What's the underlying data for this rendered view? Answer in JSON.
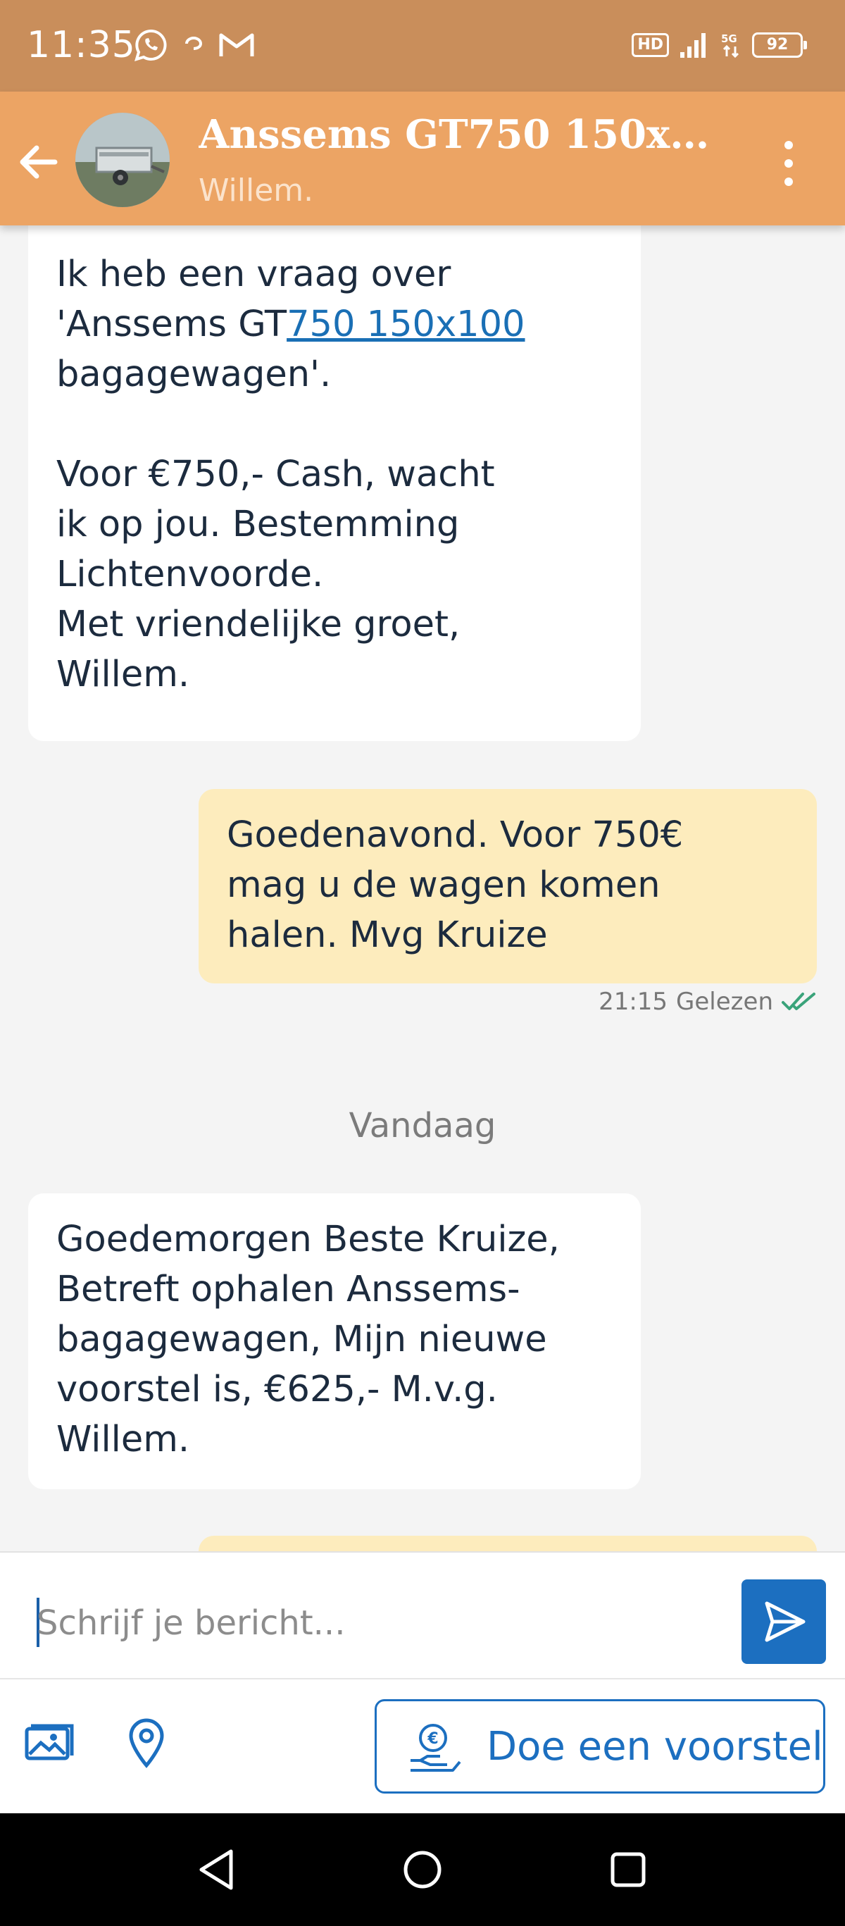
{
  "status_bar": {
    "time": "11:35",
    "icons": [
      "whatsapp-icon",
      "mail-sync-icon",
      "gmail-icon",
      "hd-icon",
      "signal-icon",
      "5g-icon",
      "battery-icon"
    ],
    "hd_label": "HD",
    "battery_level": "92"
  },
  "header": {
    "title": "Anssems GT750 150x10...",
    "subtitle": "Willem.",
    "back_icon": "arrow-left-icon",
    "menu_icon": "more-vertical-icon"
  },
  "messages": [
    {
      "direction": "incoming",
      "lines": [
        "Ik heb een vraag over",
        "'Anssems GT",
        "750 150x100",
        "bagagewagen'.",
        "",
        "Voor €750,- Cash, wacht",
        "ik op jou. Bestemming",
        "Lichtenvoorde.",
        "Met vriendelijke groet,",
        "Willem."
      ]
    },
    {
      "direction": "outgoing",
      "lines": [
        "Goedenavond. Voor 750€",
        "mag u de wagen komen",
        "halen. Mvg Kruize"
      ],
      "time": "21:15",
      "status": "Gelezen"
    },
    {
      "direction": "incoming",
      "lines": [
        "Goedemorgen  Beste Kruize,",
        "Betreft ophalen Anssems-",
        "bagagewagen, Mijn nieuwe",
        "voorstel is,  €625,- M.v.g.",
        "Willem."
      ]
    }
  ],
  "date_separator": "Vandaag",
  "composer": {
    "placeholder": "Schrijf je bericht..."
  },
  "actions": {
    "offer_label": "Doe een voorstel"
  },
  "colors": {
    "status_bar": "#c98e5b",
    "header": "#eca464",
    "incoming_bubble": "#ffffff",
    "outgoing_bubble": "#fdecbd",
    "accent_blue": "#1c6fc0",
    "read_check": "#3aa37a"
  }
}
